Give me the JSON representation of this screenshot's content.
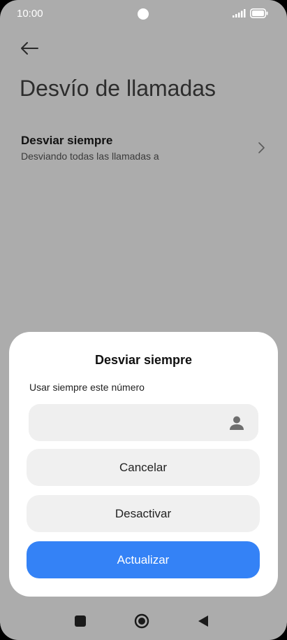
{
  "status_bar": {
    "time": "10:00"
  },
  "app_bar": {
    "back_icon": "arrow-left-icon",
    "title": "Desvío de llamadas"
  },
  "settings": {
    "items": [
      {
        "title": "Desviar siempre",
        "subtitle": "Desviando todas las llamadas a",
        "icon": "chevron-right-icon"
      }
    ]
  },
  "dialog": {
    "title": "Desviar siempre",
    "label": "Usar siempre este número",
    "input_value": "",
    "input_placeholder": "",
    "contact_icon": "person-icon",
    "buttons": {
      "cancel": "Cancelar",
      "deactivate": "Desactivar",
      "update": "Actualizar"
    }
  },
  "colors": {
    "background_dimmed": "#acacac",
    "dialog_bg": "#ffffff",
    "button_secondary": "#f0f0f0",
    "button_primary": "#3482f6",
    "button_primary_text": "#ffffff"
  },
  "nav_bar": {
    "recents_icon": "square-icon",
    "home_icon": "circle-icon",
    "back_icon": "triangle-back-icon"
  }
}
